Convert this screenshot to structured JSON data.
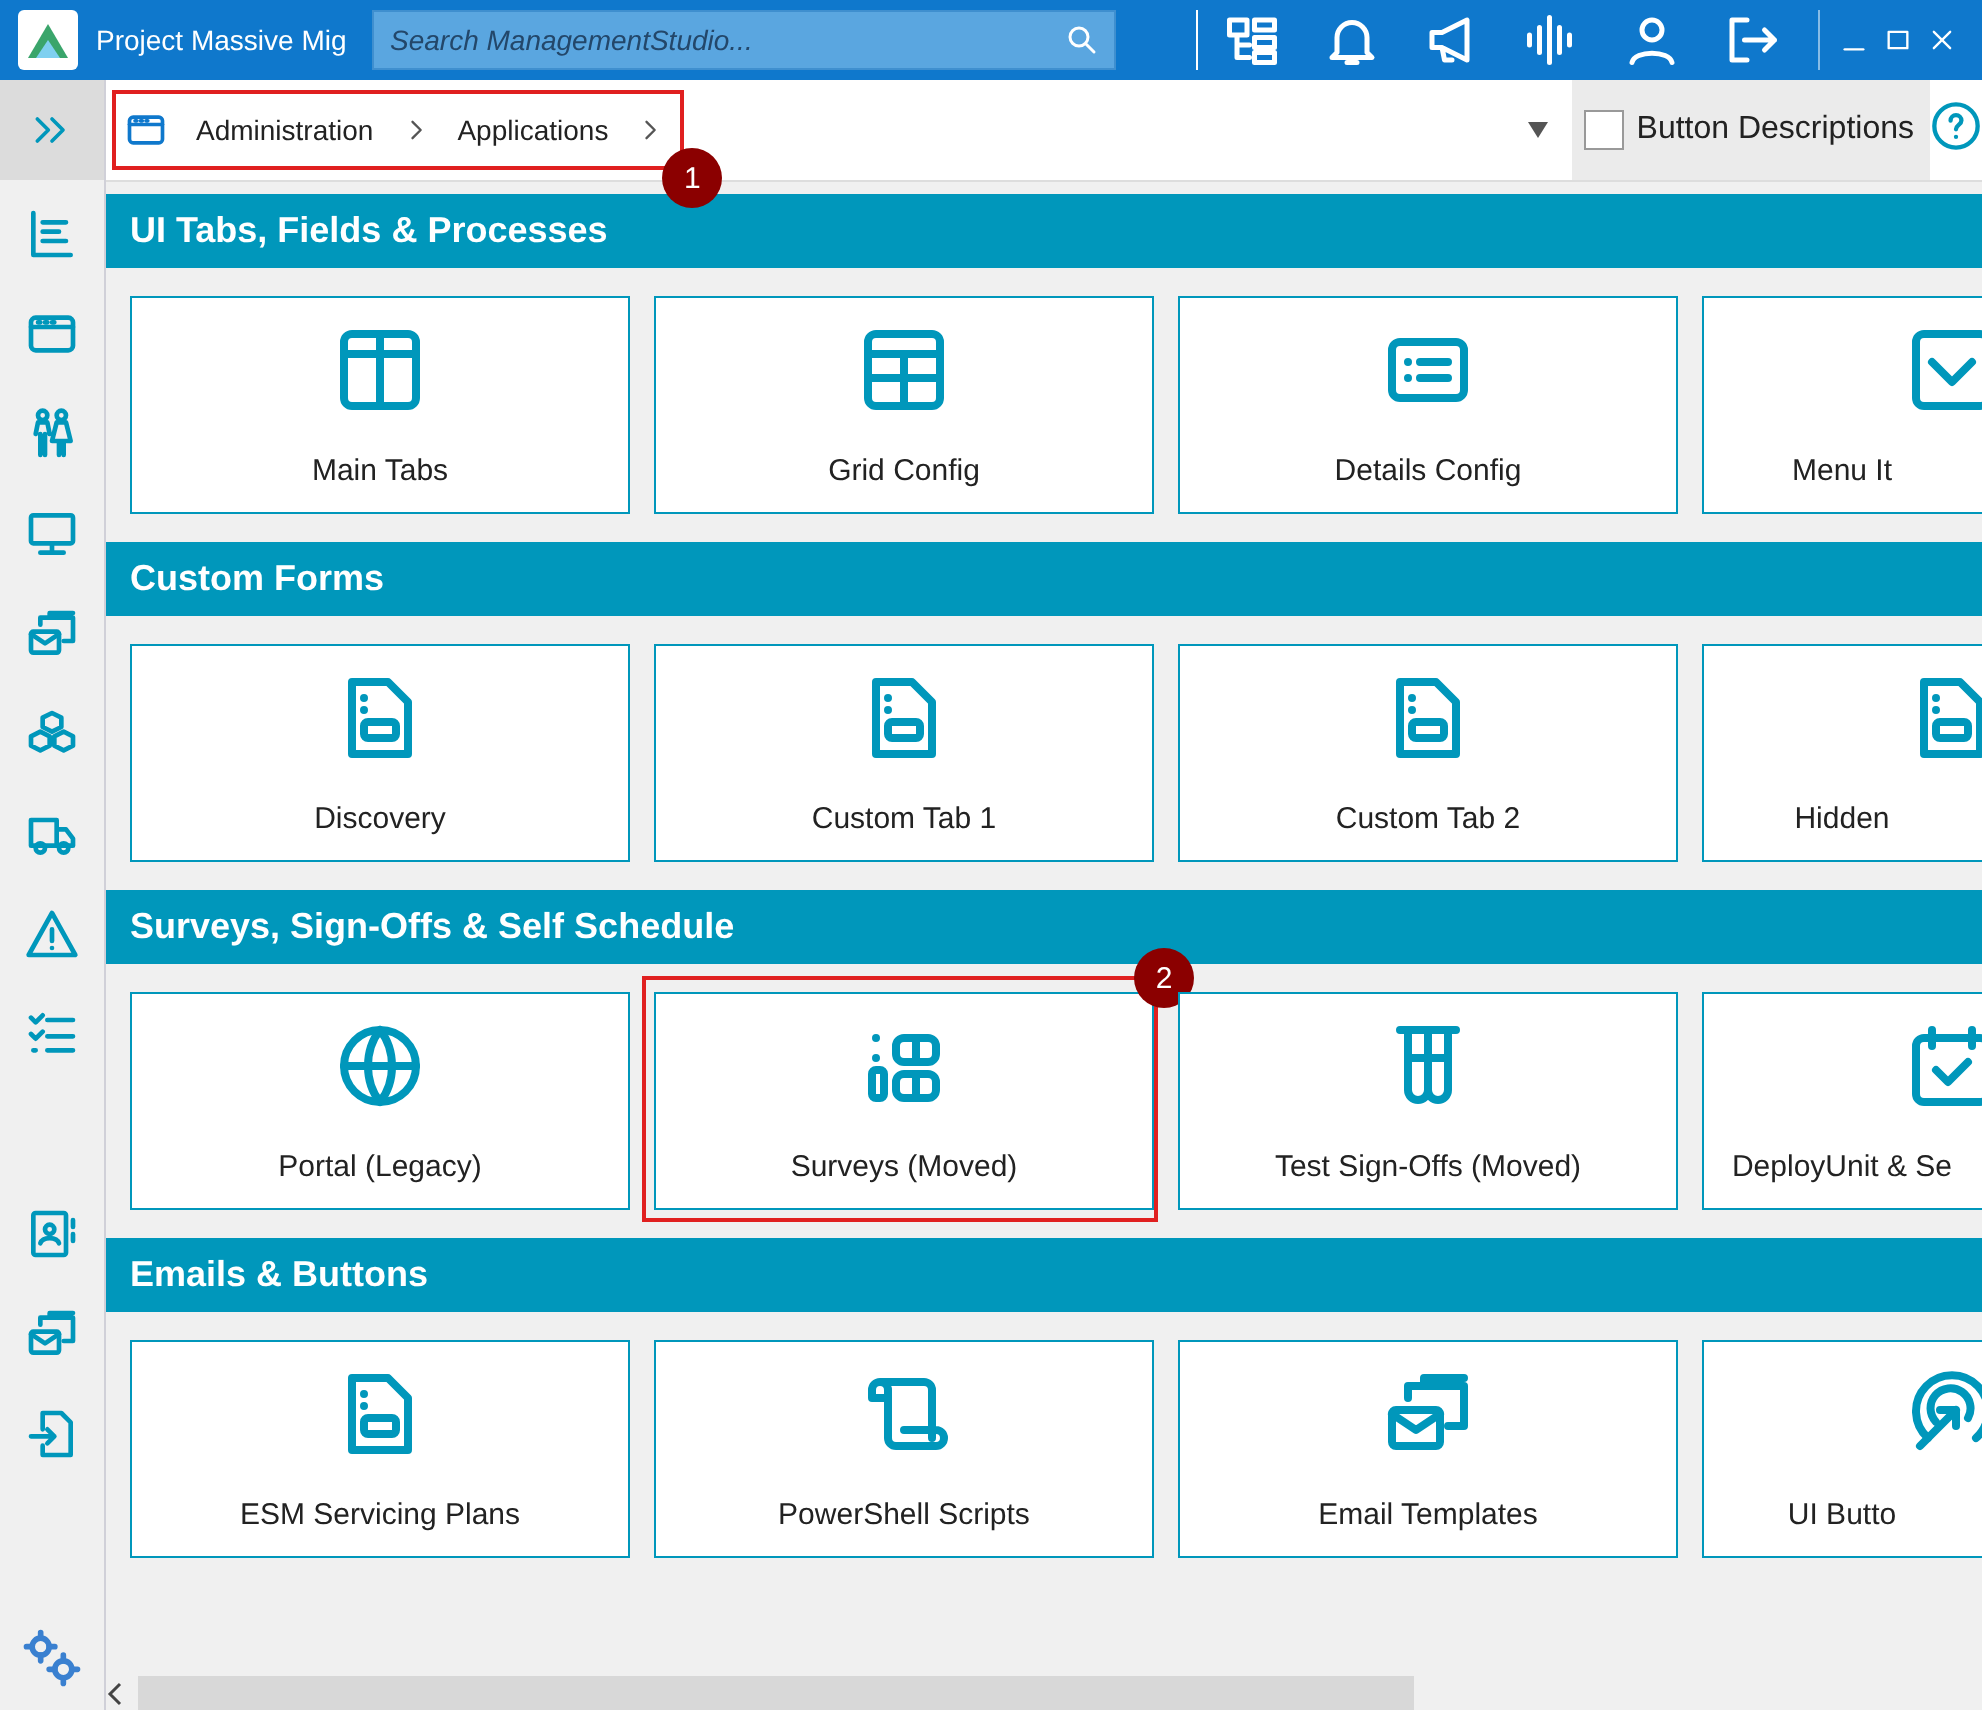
{
  "window": {
    "title": "Project Massive Mig",
    "search": {
      "placeholder": "Search ManagementStudio..."
    }
  },
  "breadcrumb": {
    "items": [
      "Administration",
      "Applications"
    ],
    "annotation": "1"
  },
  "button_descriptions": {
    "label": "Button Descriptions",
    "checked": false
  },
  "sections": [
    {
      "title": "UI Tabs, Fields & Processes",
      "tiles": [
        {
          "label": "Main Tabs"
        },
        {
          "label": "Grid Config"
        },
        {
          "label": "Details Config"
        },
        {
          "label": "Menu It"
        }
      ]
    },
    {
      "title": "Custom Forms",
      "tiles": [
        {
          "label": "Discovery"
        },
        {
          "label": "Custom Tab 1"
        },
        {
          "label": "Custom Tab 2"
        },
        {
          "label": "Hidden"
        }
      ]
    },
    {
      "title": "Surveys, Sign-Offs & Self Schedule",
      "tiles": [
        {
          "label": "Portal (Legacy)"
        },
        {
          "label": "Surveys (Moved)",
          "annotation": "2"
        },
        {
          "label": "Test Sign-Offs (Moved)"
        },
        {
          "label": "DeployUnit & Se"
        }
      ]
    },
    {
      "title": "Emails & Buttons",
      "tiles": [
        {
          "label": "ESM Servicing Plans"
        },
        {
          "label": "PowerShell Scripts"
        },
        {
          "label": "Email Templates"
        },
        {
          "label": "UI Butto"
        }
      ]
    }
  ]
}
